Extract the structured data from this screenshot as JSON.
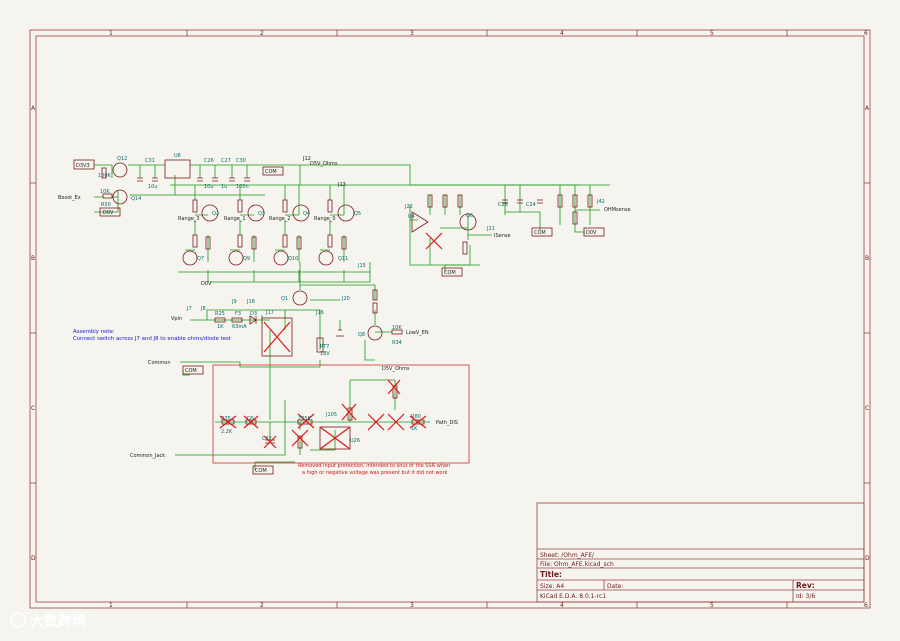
{
  "frame": {
    "cols": [
      "1",
      "2",
      "3",
      "4",
      "5",
      "6"
    ],
    "rows": [
      "A",
      "B",
      "C",
      "D"
    ]
  },
  "title_block": {
    "sheet": "Sheet: /Ohm_AFE/",
    "file": "File: Ohm_AFE.kicad_sch",
    "title": "Title:",
    "size": "Size: A4",
    "date": "Date:",
    "rev": "Rev:",
    "tool": "KiCad E.D.A. 8.0.1-rc1",
    "id": "Id: 3/6"
  },
  "labels": {
    "d3v3": "D3V3",
    "boost_ex": "Boost_Ex",
    "d0v": "D0V",
    "com": "COM",
    "vpin": "Vpin",
    "common": "Common",
    "common_jack": "Common_Jack",
    "ohmsense": "OHMsense",
    "isense": "ISense",
    "lowv_en": "LowV_EN",
    "path_dis": "Path_DIS",
    "d5v_ohms": "D5V_Ohms",
    "range_3": "Range_3",
    "range_1": "Range_1",
    "range_2": "Range_2",
    "range_0": "Range_0"
  },
  "refs": {
    "q12": "Q12",
    "q14": "Q14",
    "r50": "R50",
    "r50v": "10K",
    "r_top": "100K",
    "c31": "C31",
    "c31v": "10u",
    "u6": "U6",
    "c26": "C26",
    "c27": "C27",
    "c30": "C30",
    "c26v": "10u",
    "c27v": "1u",
    "c30v": "100n",
    "j12": "J12",
    "j13": "J13",
    "q2": "Q2",
    "q3": "Q3",
    "q4": "Q4",
    "q5": "Q5",
    "q7": "Q7",
    "q9": "Q9",
    "q10": "Q10",
    "q11": "Q11",
    "j15": "J15",
    "j22": "J22",
    "u4": "U4",
    "q6": "Q6",
    "j21": "J21",
    "j42": "J42",
    "c24": "C24",
    "c28": "C28",
    "q1": "Q1",
    "j20": "J20",
    "r32": "R32",
    "r33": "R33",
    "q8": "Q8",
    "r34": "R34",
    "r34v": "10K",
    "j7": "J7",
    "j8": "J8",
    "j9": "J9",
    "j18": "J18",
    "j17": "J17",
    "r25": "R25",
    "r25v": "1K",
    "j16": "J16",
    "ft3": "F3",
    "ft3v": "63mA",
    "d3": "D3",
    "rt7": "RT7",
    "rt7v": "18V",
    "r75": "R75",
    "r75v": "2.2K",
    "d5": "D5",
    "r77": "R77",
    "r77v": "225K",
    "j105": "J105",
    "u26": "U26",
    "r80": "R80",
    "r80v": "1K",
    "c32": "C32"
  },
  "notes": {
    "assembly_title": "Assembly note:",
    "assembly_body": "Connect switch across J7 and J8 to enable ohms/diode test",
    "removed_1": "Removed input protection, intended to shut of the SSR when",
    "removed_2": "a high or negative voltage was present but it did not work"
  },
  "watermark": "大数跨境",
  "colors": {
    "frame": "#a04040",
    "wire": "#1a9a1a",
    "part": "#7a1a1a",
    "dnp": "#e01818",
    "note": "#1818c8"
  }
}
